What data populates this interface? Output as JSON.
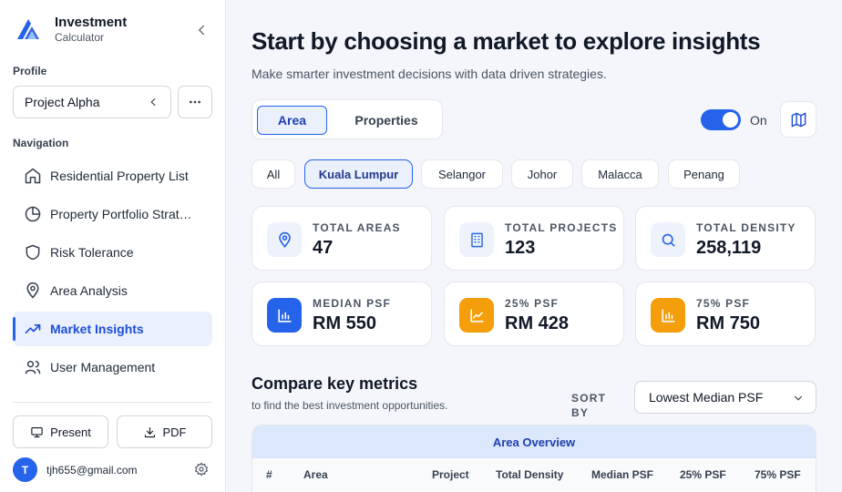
{
  "brand": {
    "title": "Investment",
    "subtitle": "Calculator"
  },
  "profile": {
    "label": "Profile",
    "selected": "Project Alpha"
  },
  "navigation": {
    "label": "Navigation",
    "items": [
      {
        "label": "Residential Property List",
        "icon": "home-icon"
      },
      {
        "label": "Property Portfolio Strat…",
        "icon": "pie-chart-icon"
      },
      {
        "label": "Risk Tolerance",
        "icon": "shield-icon"
      },
      {
        "label": "Area Analysis",
        "icon": "map-pin-icon"
      },
      {
        "label": "Market Insights",
        "icon": "trending-up-icon",
        "active": true
      },
      {
        "label": "User Management",
        "icon": "users-icon"
      }
    ]
  },
  "actions": {
    "present": "Present",
    "pdf": "PDF"
  },
  "user": {
    "initial": "T",
    "email": "tjh655@gmail.com"
  },
  "header": {
    "title": "Start by choosing a market to explore insights",
    "subtitle": "Make smarter investment decisions with data driven strategies."
  },
  "view_tabs": {
    "area": "Area",
    "properties": "Properties"
  },
  "toggle": {
    "label": "On",
    "on": true
  },
  "markets": [
    "All",
    "Kuala Lumpur",
    "Selangor",
    "Johor",
    "Malacca",
    "Penang"
  ],
  "selected_market": "Kuala Lumpur",
  "stats": [
    {
      "label": "TOTAL AREAS",
      "value": "47",
      "icon": "map-pin-icon"
    },
    {
      "label": "TOTAL PROJECTS",
      "value": "123",
      "icon": "building-icon"
    },
    {
      "label": "TOTAL DENSITY",
      "value": "258,119",
      "icon": "search-icon"
    },
    {
      "label": "MEDIAN PSF",
      "value": "RM 550",
      "icon": "bar-chart-icon"
    },
    {
      "label": "25% PSF",
      "value": "RM 428",
      "icon": "line-chart-icon"
    },
    {
      "label": "75% PSF",
      "value": "RM 750",
      "icon": "bar-chart-icon"
    }
  ],
  "compare": {
    "title": "Compare key metrics",
    "subtitle": "to find the best investment opportunities.",
    "sort_label": "SORT BY",
    "sort_value": "Lowest Median PSF"
  },
  "table": {
    "title": "Area Overview",
    "columns": [
      "#",
      "Area",
      "Project",
      "Total Density",
      "Median PSF",
      "25% PSF",
      "75% PSF"
    ]
  },
  "colors": {
    "accent": "#2563eb",
    "accent_soft": "#eaf0fc",
    "orange": "#f59e0b"
  }
}
